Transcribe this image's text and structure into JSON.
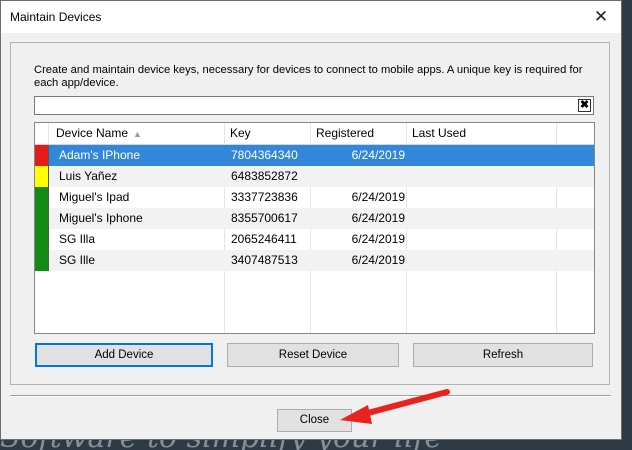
{
  "window": {
    "title": "Maintain Devices",
    "close_glyph": "✕"
  },
  "description": "Create and maintain device keys, necessary for devices to connect to mobile apps.  A unique key is required for each app/device.",
  "filter": {
    "value": "",
    "clear_glyph": "✖"
  },
  "table": {
    "columns": [
      "Device Name",
      "Key",
      "Registered",
      "Last Used"
    ],
    "sort_indicator": "▲",
    "rows": [
      {
        "name": "Adam's IPhone",
        "key": "7804364340",
        "registered": "6/24/2019",
        "last_used": "",
        "status_color": "#e41b17",
        "selected": true
      },
      {
        "name": "Luis Yañez",
        "key": "6483852872",
        "registered": "",
        "last_used": "",
        "status_color": "#ffff00",
        "selected": false
      },
      {
        "name": "Miguel's Ipad",
        "key": "3337723836",
        "registered": "6/24/2019",
        "last_used": "",
        "status_color": "#138a13",
        "selected": false
      },
      {
        "name": "Miguel's Iphone",
        "key": "8355700617",
        "registered": "6/24/2019",
        "last_used": "",
        "status_color": "#138a13",
        "selected": false
      },
      {
        "name": "SG Illa",
        "key": "2065246411",
        "registered": "6/24/2019",
        "last_used": "",
        "status_color": "#138a13",
        "selected": false
      },
      {
        "name": "SG Ille",
        "key": "3407487513",
        "registered": "6/24/2019",
        "last_used": "",
        "status_color": "#138a13",
        "selected": false
      }
    ]
  },
  "buttons": {
    "add": "Add Device",
    "reset": "Reset Device",
    "refresh": "Refresh",
    "close": "Close"
  },
  "background_text": "Software to simplify your life",
  "annotation": {
    "arrow_color": "#e8221c"
  }
}
